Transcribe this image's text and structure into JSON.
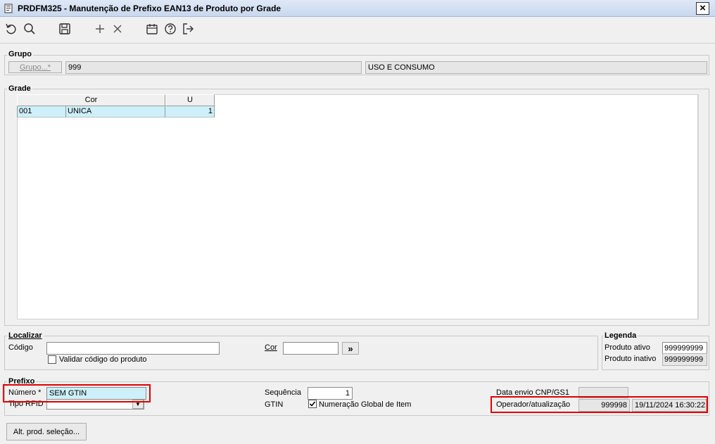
{
  "window": {
    "title": "PRDFM325 - Manutenção de Prefixo EAN13 de Produto por Grade",
    "close_label": "×"
  },
  "toolbar": {
    "icons": [
      "undo-icon",
      "search-icon",
      "save-icon",
      "add-icon",
      "delete-icon",
      "calendar-icon",
      "help-icon",
      "exit-icon"
    ]
  },
  "grupo": {
    "title": "Grupo",
    "button_label": "Grupo...*",
    "code": "999",
    "description": "USO E CONSUMO"
  },
  "grade": {
    "title": "Grade",
    "columns": [
      "Cor",
      "U"
    ],
    "rows": [
      {
        "code": "001",
        "cor": "UNICA",
        "u": "1"
      }
    ]
  },
  "localizar": {
    "title": "Localizar",
    "codigo_label": "Código",
    "codigo_value": "",
    "cor_label": "Cor",
    "cor_value": "",
    "go_label": "»",
    "validar_label": "Validar código do produto",
    "validar_checked": false
  },
  "legenda": {
    "title": "Legenda",
    "ativo_label": "Produto ativo",
    "ativo_value": "999999999",
    "inativo_label": "Produto inativo",
    "inativo_value": "999999999"
  },
  "prefixo": {
    "title": "Prefixo",
    "numero_label": "Número *",
    "numero_value": "SEM GTIN",
    "tipo_rfid_label": "Tipo RFID",
    "tipo_rfid_value": "",
    "sequencia_label": "Sequência",
    "sequencia_value": "1",
    "gtin_label": "GTIN",
    "gtin_check_label": "Numeração Global de Item",
    "gtin_checked": true,
    "data_envio_label": "Data envio CNP/GS1",
    "data_envio_value": "",
    "operador_label": "Operador/atualização",
    "operador_value": "999998",
    "atualizacao_value": "19/11/2024 16:30:22"
  },
  "footer": {
    "alt_button_label": "Alt. prod. seleção..."
  },
  "colors": {
    "highlight_red": "#e00000",
    "grid_selected": "#cdf0fa"
  }
}
